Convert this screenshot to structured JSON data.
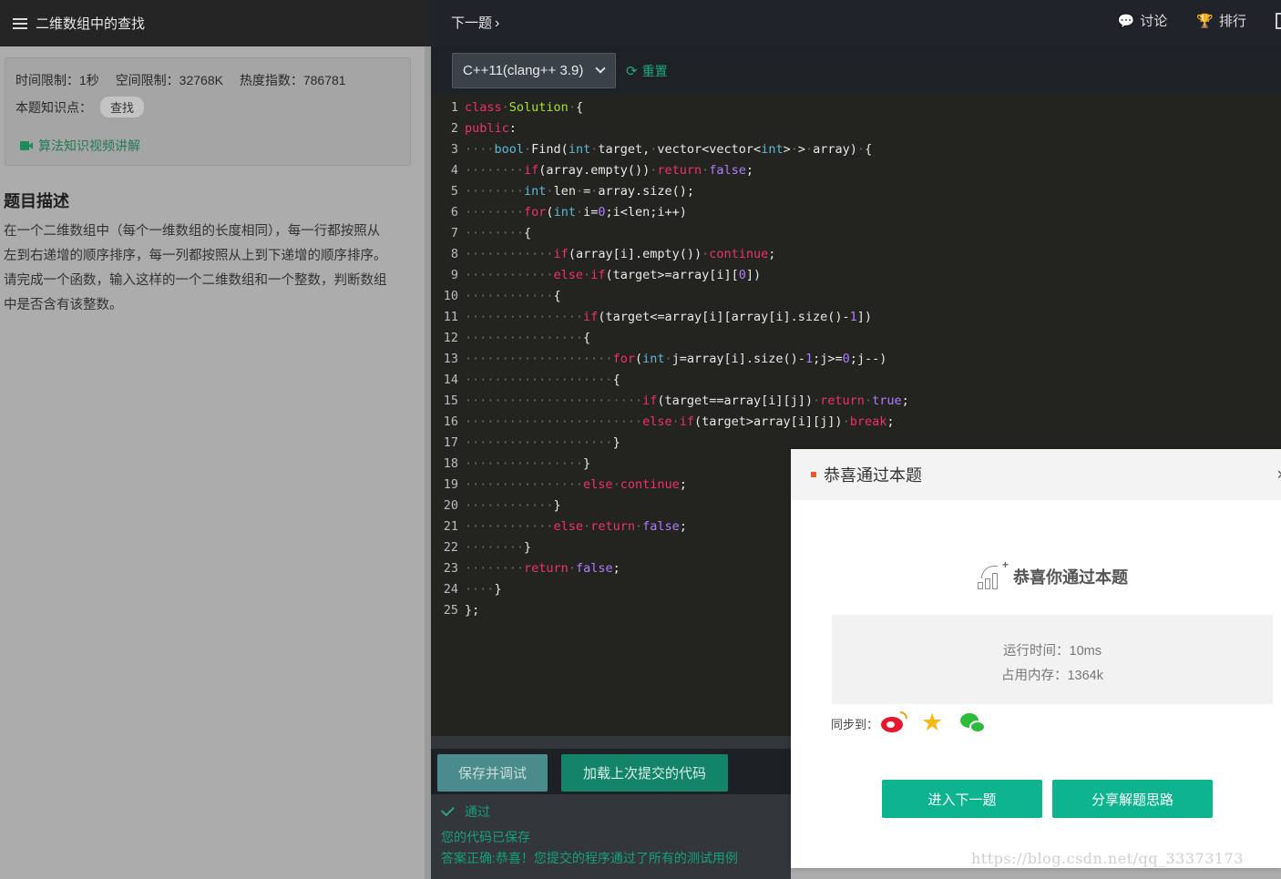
{
  "left": {
    "title": "二维数组中的查找",
    "time_limit": "时间限制：1秒",
    "space_limit": "空间限制：32768K",
    "heat": "热度指数：786781",
    "knowledge_label": "本题知识点：",
    "knowledge_tag": "查找",
    "video_link": "算法知识视频讲解",
    "desc_title": "题目描述",
    "desc_lines": [
      "在一个二维数组中（每个一维数组的长度相同），每一行都按照从",
      "左到右递增的顺序排序，每一列都按照从上到下递增的顺序排序。",
      "请完成一个函数，输入这样的一个二维数组和一个整数，判断数组",
      "中是否含有该整数。"
    ]
  },
  "header": {
    "next": "下一题",
    "discuss": "讨论",
    "rank": "排行"
  },
  "toolbar": {
    "language": "C++11(clang++ 3.9)",
    "reset": "重置"
  },
  "code_lines": [
    "1",
    "2",
    "3",
    "4",
    "5",
    "6",
    "7",
    "8",
    "9",
    "10",
    "11",
    "12",
    "13",
    "14",
    "15",
    "16",
    "17",
    "18",
    "19",
    "20",
    "21",
    "22",
    "23",
    "24",
    "25"
  ],
  "actions": {
    "save": "保存并调试",
    "load": "加载上次提交的代码"
  },
  "result": {
    "status": "通过",
    "saved": "您的代码已保存",
    "correct": "答案正确:恭喜！您提交的程序通过了所有的测试用例"
  },
  "modal": {
    "title": "恭喜通过本题",
    "close": "×",
    "congrats": "恭喜你通过本题",
    "runtime": "运行时间：10ms",
    "memory": "占用内存：1364k",
    "sync_label": "同步到：",
    "next_button": "进入下一题",
    "share_button": "分享解题思路"
  },
  "watermark": "https://blog.csdn.net/qq_33373173",
  "colors": {
    "accent": "#0eb38f",
    "keyword": "#f0316a",
    "type": "#5fb8d8",
    "number": "#ae7bff"
  }
}
